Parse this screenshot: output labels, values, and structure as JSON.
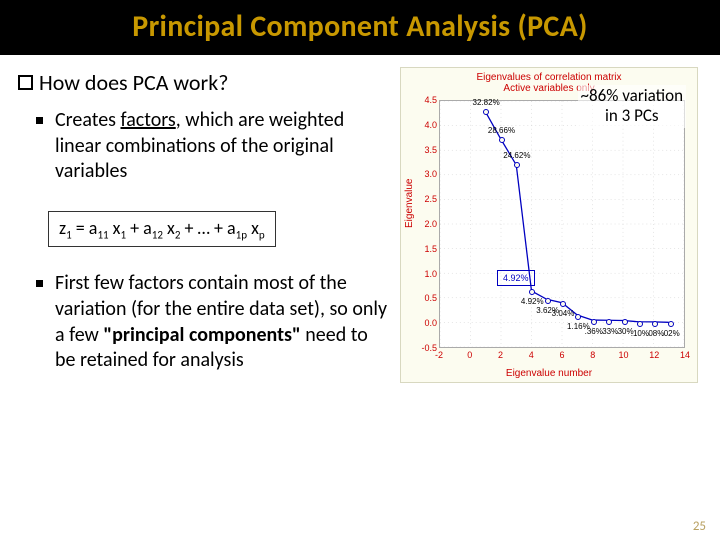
{
  "title": "Principal Component Analysis (PCA)",
  "heading": "How does PCA work?",
  "bullet1": {
    "pre": "Creates ",
    "u": "factors",
    "post": ", which are weighted linear combinations of the original variables"
  },
  "equation": {
    "z": "z",
    "z1": "1",
    "eq": " = a",
    "a11": "11",
    "x": " x",
    "x1": "1",
    "plus": " + a",
    "a12": "12",
    "x2": "2",
    "dots": " + … + a",
    "a1p": "1p",
    "xp": "p"
  },
  "bullet2": {
    "pre": "First few factors contain most of the variation (for the entire data set), so only a few ",
    "bold": "\"principal components\"",
    "post": " need to be retained for analysis"
  },
  "annotation": {
    "l1": "~86% variation",
    "l2": "in 3 PCs"
  },
  "page_num": "25",
  "chart_data": {
    "type": "line",
    "title": "Eigenvalues of correlation matrix",
    "subtitle": "Active variables only",
    "xlabel": "Eigenvalue number",
    "ylabel": "Eigenvalue",
    "xlim": [
      -2,
      14
    ],
    "ylim": [
      -0.5,
      4.5
    ],
    "xticks": [
      -2,
      0,
      2,
      4,
      6,
      8,
      10,
      12,
      14
    ],
    "yticks": [
      -0.5,
      0.0,
      0.5,
      1.0,
      1.5,
      2.0,
      2.5,
      3.0,
      3.5,
      4.0,
      4.5
    ],
    "x": [
      1,
      2,
      3,
      4,
      5,
      6,
      7,
      8,
      9,
      10,
      11,
      12,
      13
    ],
    "values": [
      4.27,
      3.72,
      3.2,
      0.64,
      0.47,
      0.4,
      0.15,
      0.047,
      0.043,
      0.039,
      0.013,
      0.01,
      0.002
    ],
    "labels": [
      "32.82%",
      "28.66%",
      "24.62%",
      "4.92%",
      "3.62%",
      "3.04%",
      "1.16%",
      ".36%",
      ".33%",
      ".30%",
      ".10%",
      ".08%",
      ".02%"
    ],
    "callout": "4.92%"
  }
}
